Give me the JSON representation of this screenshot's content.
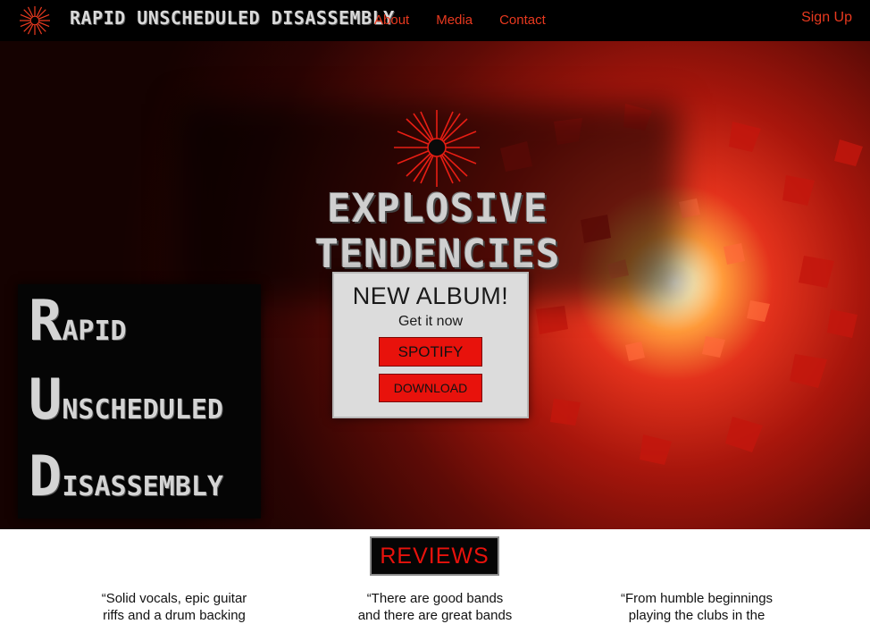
{
  "nav": {
    "logo_icon": "starburst-logo-icon",
    "brand_title": "RAPID UNSCHEDULED DISASSEMBLY",
    "links": [
      "About",
      "Media",
      "Contact"
    ],
    "signup_label": "Sign Up",
    "accent_color": "#e8391f"
  },
  "hero": {
    "burst_icon": "starburst-icon",
    "title": "EXPLOSIVE TENDENCIES",
    "album": {
      "heading": "NEW ALBUM!",
      "subheading": "Get it now",
      "spotify_label": "SPOTIFY",
      "download_label": "DOWNLOAD",
      "button_color": "#e8120c"
    },
    "band_logo": {
      "line1_initial": "R",
      "line1_rest": "APID",
      "line2_initial": "U",
      "line2_rest": "NSCHEDULED",
      "line3_initial": "D",
      "line3_rest": "ISASSEMBLY"
    }
  },
  "reviews": {
    "heading": "REVIEWS",
    "items": [
      {
        "line1": "“Solid vocals, epic guitar",
        "line2": "riffs and a drum backing"
      },
      {
        "line1": "“There are good bands",
        "line2": "and there are great bands"
      },
      {
        "line1": "“From humble beginnings",
        "line2": "playing the clubs in the"
      }
    ]
  }
}
